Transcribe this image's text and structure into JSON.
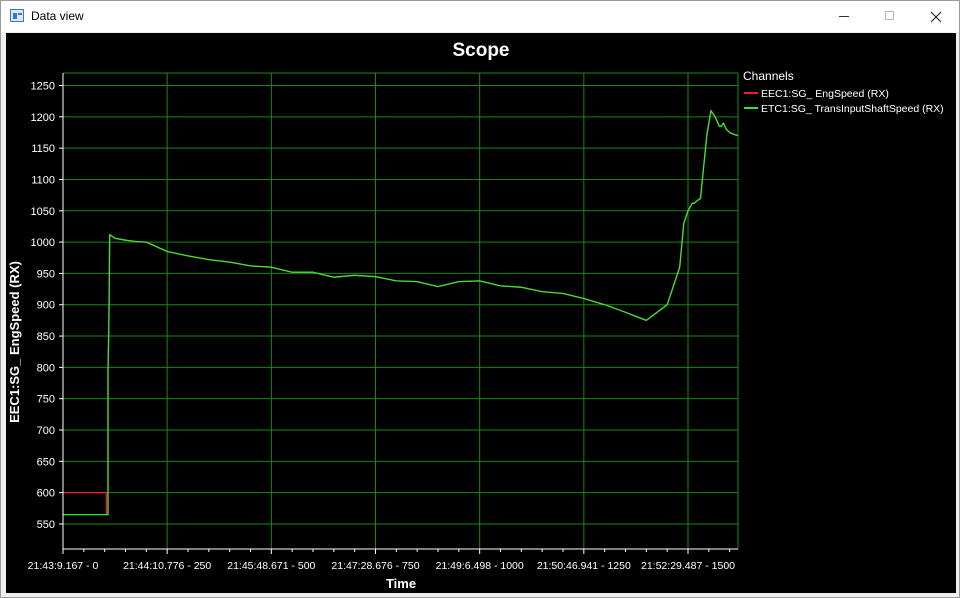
{
  "window": {
    "title": "Data view",
    "icon": "data-view-app-icon"
  },
  "colors": {
    "background": "#000000",
    "grid": "#138a13",
    "axis": "#ffffff",
    "text": "#ffffff",
    "series_engine": "#ff1a1a",
    "series_trans": "#33e833"
  },
  "chart_data": {
    "type": "line",
    "title": "Scope",
    "xlabel": "Time",
    "ylabel": "EEC1:SG_ EngSpeed  (RX)",
    "xlim": [
      0,
      1620
    ],
    "ylim": [
      510,
      1270
    ],
    "yticks": [
      550,
      600,
      650,
      700,
      750,
      800,
      850,
      900,
      950,
      1000,
      1050,
      1100,
      1150,
      1200,
      1250
    ],
    "xticks": [
      {
        "value": 0,
        "label": "21:43:9.167 - 0"
      },
      {
        "value": 250,
        "label": "21:44:10.776 - 250"
      },
      {
        "value": 500,
        "label": "21:45:48.671 - 500"
      },
      {
        "value": 750,
        "label": "21:47:28.676 - 750"
      },
      {
        "value": 1000,
        "label": "21:49:6.498 - 1000"
      },
      {
        "value": 1250,
        "label": "21:50:46.941 - 1250"
      },
      {
        "value": 1500,
        "label": "21:52:29.487 - 1500"
      }
    ],
    "grid": true,
    "legend_position": "top-right",
    "legend_title": "Channels",
    "series": [
      {
        "name": "EEC1:SG_ EngSpeed  (RX)",
        "color": "#ff1a1a",
        "x": [
          0,
          104,
          104,
          108,
          108,
          110,
          112,
          125,
          150,
          175,
          200,
          250,
          300,
          350,
          400,
          450,
          500,
          550,
          600,
          650,
          700,
          750,
          800,
          850,
          900,
          950,
          1000,
          1050,
          1100,
          1150,
          1200,
          1250,
          1300,
          1350,
          1400,
          1450,
          1480,
          1490,
          1500,
          1510,
          1515,
          1520,
          1530,
          1545,
          1555,
          1565,
          1575,
          1580,
          1585,
          1592,
          1600,
          1610,
          1620
        ],
        "y": [
          600,
          600,
          565,
          565,
          795,
          860,
          1012,
          1006,
          1003,
          1001,
          1000,
          985,
          978,
          972,
          968,
          962,
          960,
          952,
          952,
          944,
          947,
          945,
          938,
          937,
          929,
          937,
          938,
          930,
          928,
          921,
          918,
          910,
          900,
          888,
          875,
          900,
          960,
          1030,
          1050,
          1062,
          1062,
          1065,
          1070,
          1170,
          1210,
          1200,
          1185,
          1185,
          1190,
          1180,
          1175,
          1172,
          1170
        ]
      },
      {
        "name": "ETC1:SG_ TransInputShaftSpeed  (RX)",
        "color": "#33e833",
        "x": [
          0,
          108,
          108,
          110,
          112,
          125,
          150,
          175,
          200,
          250,
          300,
          350,
          400,
          450,
          500,
          550,
          600,
          650,
          700,
          750,
          800,
          850,
          900,
          950,
          1000,
          1050,
          1100,
          1150,
          1200,
          1250,
          1300,
          1350,
          1400,
          1450,
          1480,
          1490,
          1500,
          1510,
          1515,
          1520,
          1530,
          1545,
          1555,
          1565,
          1575,
          1580,
          1585,
          1592,
          1600,
          1610,
          1620
        ],
        "y": [
          565,
          565,
          795,
          860,
          1012,
          1006,
          1003,
          1001,
          1000,
          985,
          978,
          972,
          968,
          962,
          960,
          952,
          952,
          944,
          947,
          945,
          938,
          937,
          929,
          937,
          938,
          930,
          928,
          921,
          918,
          910,
          900,
          888,
          875,
          900,
          960,
          1030,
          1050,
          1062,
          1062,
          1065,
          1070,
          1170,
          1210,
          1200,
          1185,
          1185,
          1190,
          1180,
          1175,
          1172,
          1170
        ]
      }
    ]
  }
}
